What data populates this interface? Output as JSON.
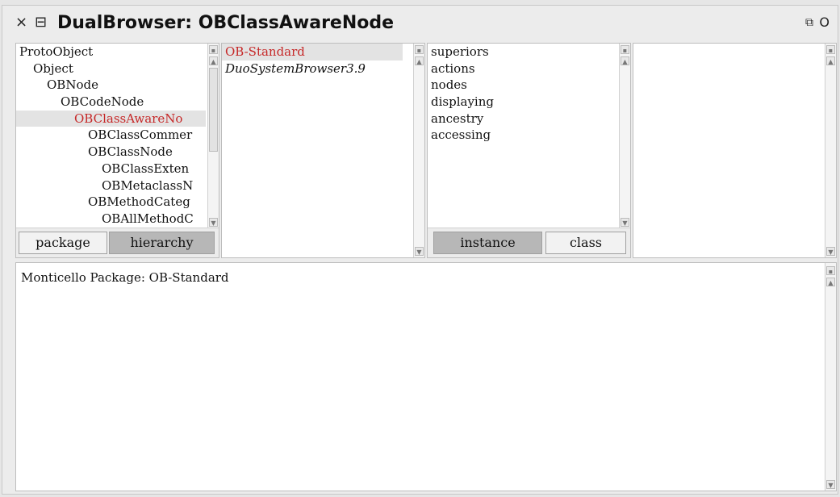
{
  "window": {
    "title": "DualBrowser: OBClassAwareNode",
    "close_glyph": "×",
    "menu_glyph": "⊟",
    "collapse_glyph": "⧉",
    "expand_glyph": "O"
  },
  "class_pane": {
    "items": [
      {
        "label": "ProtoObject",
        "indent": 0,
        "selected": false
      },
      {
        "label": "Object",
        "indent": 1,
        "selected": false
      },
      {
        "label": "OBNode",
        "indent": 2,
        "selected": false
      },
      {
        "label": "OBCodeNode",
        "indent": 3,
        "selected": false
      },
      {
        "label": "OBClassAwareNo",
        "indent": 4,
        "selected": true
      },
      {
        "label": "OBClassCommer",
        "indent": 5,
        "selected": false
      },
      {
        "label": "OBClassNode",
        "indent": 5,
        "selected": false
      },
      {
        "label": "OBClassExten",
        "indent": 6,
        "selected": false
      },
      {
        "label": "OBMetaclassN",
        "indent": 6,
        "selected": false
      },
      {
        "label": "OBMethodCateg",
        "indent": 5,
        "selected": false
      },
      {
        "label": "OBAllMethodC",
        "indent": 6,
        "selected": false
      }
    ],
    "buttons": {
      "package": "package",
      "hierarchy": "hierarchy"
    },
    "active_button": "hierarchy"
  },
  "package_pane": {
    "items": [
      {
        "label": "OB-Standard",
        "selected": true,
        "italic": false
      },
      {
        "label": "DuoSystemBrowser3.9",
        "selected": false,
        "italic": true
      }
    ]
  },
  "protocol_pane": {
    "items": [
      "superiors",
      "actions",
      "nodes",
      "displaying",
      "ancestry",
      "accessing"
    ],
    "buttons": {
      "instance": "instance",
      "class": "class"
    },
    "active_button": "instance"
  },
  "code_pane": {
    "text": "Monticello Package: OB-Standard"
  },
  "colors": {
    "selection_text": "#c62828",
    "active_toggle": "#b7b7b7"
  }
}
